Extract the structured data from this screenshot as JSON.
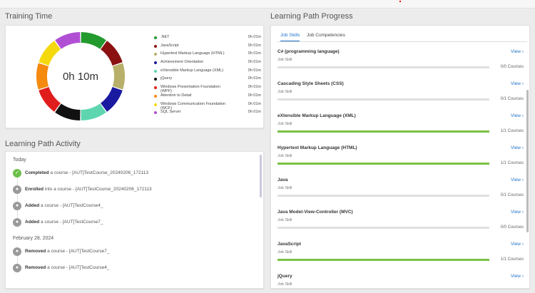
{
  "training": {
    "title": "Training Time",
    "total": "0h 10m",
    "slices": [
      {
        "label": ".NET",
        "value": "0h 01m",
        "color": "#229a2e"
      },
      {
        "label": "JavaScript",
        "value": "0h 01m",
        "color": "#8b1111"
      },
      {
        "label": "Hypertext Markup Language (HTML)",
        "value": "0h 01m",
        "color": "#b8b06a"
      },
      {
        "label": "Achievement Orientation",
        "value": "0h 01m",
        "color": "#1a1aa0"
      },
      {
        "label": "eXtensible Markup Language (XML)",
        "value": "0h 01m",
        "color": "#5dd6b0"
      },
      {
        "label": "jQuery",
        "value": "0h 01m",
        "color": "#111111"
      },
      {
        "label": "Windows Presentation Foundation (WPF)",
        "value": "0h 01m",
        "color": "#e01d1d"
      },
      {
        "label": "Attention to Detail",
        "value": "0h 01m",
        "color": "#f58a0f"
      },
      {
        "label": "Windows Communication Foundation (WCF)",
        "value": "0h 01m",
        "color": "#f5d90f"
      },
      {
        "label": "SQL Server",
        "value": "0h 01m",
        "color": "#b04fd4"
      }
    ]
  },
  "activity": {
    "title": "Learning Path Activity",
    "groups": [
      {
        "day": "Today",
        "items": [
          {
            "action": "Completed",
            "rest": " a course - [AUT]TestCourse_20240206_172113",
            "status": "done"
          },
          {
            "action": "Enrolled",
            "rest": " into a course - [AUT]TestCourse_20240206_172113",
            "status": "other"
          },
          {
            "action": "Added",
            "rest": " a course - [AUT]TestCourse4_",
            "status": "other"
          },
          {
            "action": "Added",
            "rest": " a course - [AUT]TestCourse7_",
            "status": "other"
          }
        ]
      },
      {
        "day": "February 28, 2024",
        "items": [
          {
            "action": "Removed",
            "rest": " a course - [AUT]TestCourse7_",
            "status": "other"
          },
          {
            "action": "Removed",
            "rest": " a course - [AUT]TestCourse4_",
            "status": "other"
          }
        ]
      }
    ]
  },
  "progress": {
    "title": "Learning Path Progress",
    "tabs": [
      "Job Skills",
      "Job Competencies"
    ],
    "view_label": "View",
    "skills": [
      {
        "name": "C# (programming language)",
        "type": "Job Skill",
        "count": "0/0 Courses",
        "fraction": 0
      },
      {
        "name": "Cascading Style Sheets (CSS)",
        "type": "Job Skill",
        "count": "0/1 Courses",
        "fraction": 0
      },
      {
        "name": "eXtensible Markup Language (XML)",
        "type": "Job Skill",
        "count": "1/1 Courses",
        "fraction": 1
      },
      {
        "name": "Hypertext Markup Language (HTML)",
        "type": "Job Skill",
        "count": "1/1 Courses",
        "fraction": 1
      },
      {
        "name": "Java",
        "type": "Job Skill",
        "count": "0/1 Courses",
        "fraction": 0
      },
      {
        "name": "Java Model-View-Controller (MVC)",
        "type": "Job Skill",
        "count": "0/0 Courses",
        "fraction": 0
      },
      {
        "name": "JavaScript",
        "type": "Job Skill",
        "count": "1/1 Courses",
        "fraction": 1
      },
      {
        "name": "jQuery",
        "type": "Job Skill",
        "count": "",
        "fraction": 0
      }
    ]
  }
}
